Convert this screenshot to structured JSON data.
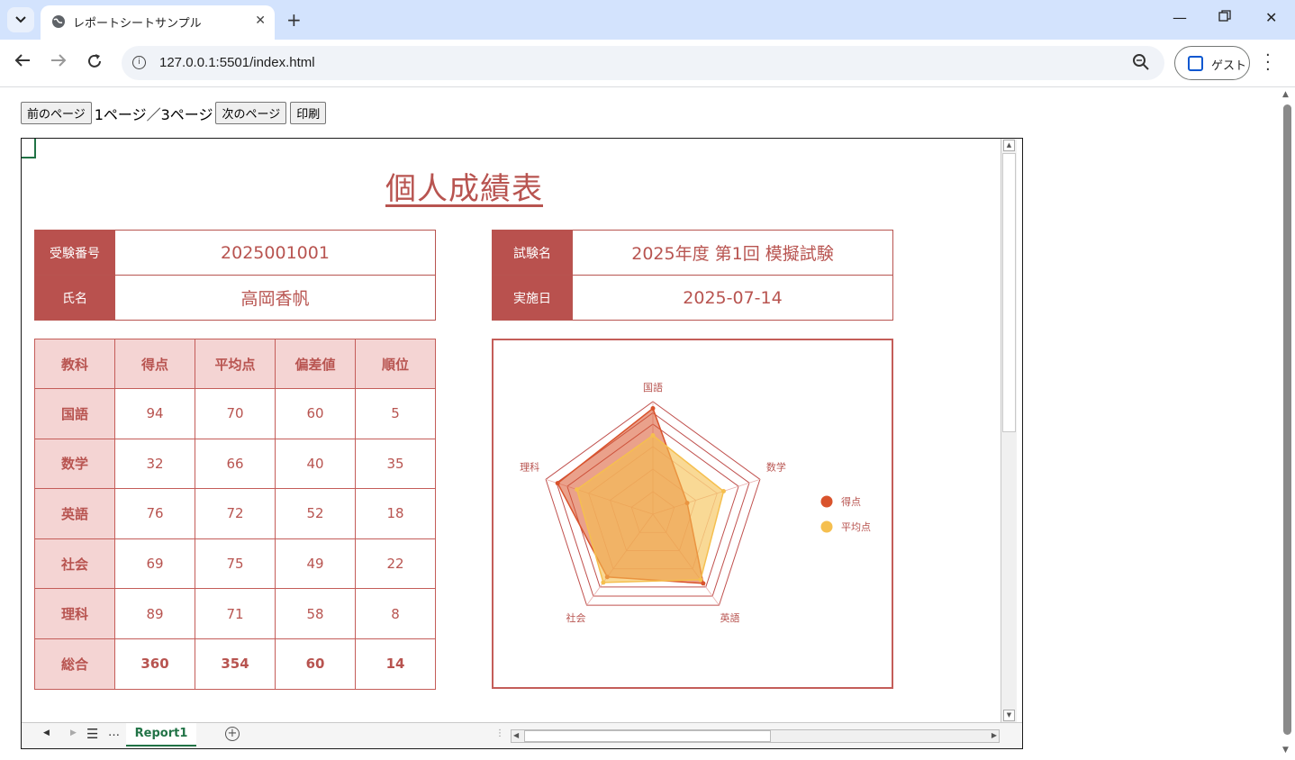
{
  "browser": {
    "tab_title": "レポートシートサンプル",
    "url": "127.0.0.1:5501/index.html",
    "profile_label": "ゲスト"
  },
  "pager": {
    "prev_label": "前のページ",
    "page_info": "1ページ／3ページ",
    "next_label": "次のページ",
    "print_label": "印刷"
  },
  "report": {
    "title": "個人成績表",
    "info_left": [
      {
        "label": "受験番号",
        "value": "2025001001"
      },
      {
        "label": "氏名",
        "value": "高岡香帆"
      }
    ],
    "info_right": [
      {
        "label": "試験名",
        "value": "2025年度 第1回 模擬試験"
      },
      {
        "label": "実施日",
        "value": "2025-07-14"
      }
    ],
    "table": {
      "headers": [
        "教科",
        "得点",
        "平均点",
        "偏差値",
        "順位"
      ],
      "rows": [
        [
          "国語",
          "94",
          "70",
          "60",
          "5"
        ],
        [
          "数学",
          "32",
          "66",
          "40",
          "35"
        ],
        [
          "英語",
          "76",
          "72",
          "52",
          "18"
        ],
        [
          "社会",
          "69",
          "75",
          "49",
          "22"
        ],
        [
          "理科",
          "89",
          "71",
          "58",
          "8"
        ]
      ],
      "total": [
        "総合",
        "360",
        "354",
        "60",
        "14"
      ]
    }
  },
  "chart_data": {
    "type": "radar",
    "categories": [
      "国語",
      "数学",
      "英語",
      "社会",
      "理科"
    ],
    "series": [
      {
        "name": "得点",
        "values": [
          94,
          32,
          76,
          69,
          89
        ],
        "color": "#d9532c"
      },
      {
        "name": "平均点",
        "values": [
          70,
          66,
          72,
          75,
          71
        ],
        "color": "#f5bf4f"
      }
    ],
    "range": [
      0,
      100
    ],
    "legend": "right"
  },
  "sheet": {
    "tab_name": "Report1"
  }
}
